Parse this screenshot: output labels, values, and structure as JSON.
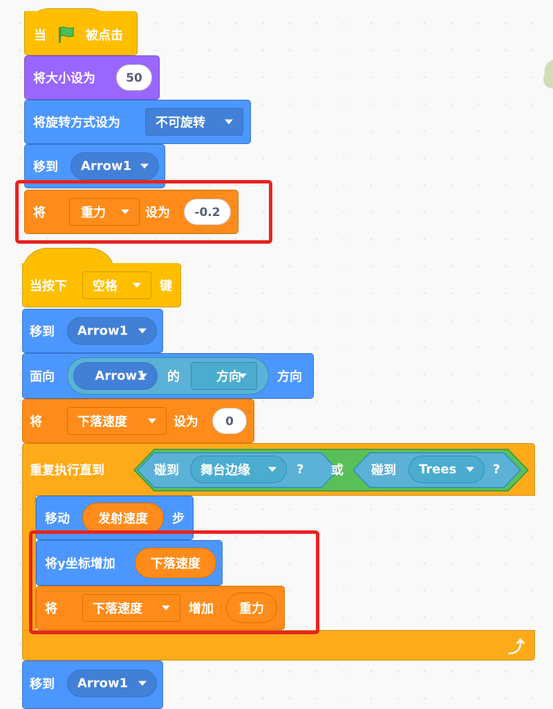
{
  "script1": {
    "when_label": "当",
    "clicked_label": "被点击",
    "set_size_label": "将大小设为",
    "set_size_value": "50",
    "set_rotation_label": "将旋转方式设为",
    "rotation_option": "不可旋转",
    "go_to_label": "移到",
    "go_to_target": "Arrow1",
    "set_var_label": "将",
    "set_var_name": "重力",
    "set_to_label": "设为",
    "set_var_value": "-0.2"
  },
  "script2": {
    "when_key_label": "当按下",
    "key_option": "空格",
    "key_suffix": "键",
    "go_to_label": "移到",
    "go_to_target": "Arrow1",
    "point_label": "面向",
    "of_object": "Arrow1",
    "of_label": "的",
    "of_property": "方向",
    "point_suffix": "方向",
    "set_var_label": "将",
    "set_var_name": "下落速度",
    "set_to_label": "设为",
    "set_var_value": "0",
    "repeat_until_label": "重复执行直到",
    "touching_label_1": "碰到",
    "touching_target_1": "舞台边缘",
    "question_1": "?",
    "or_label": "或",
    "touching_label_2": "碰到",
    "touching_target_2": "Trees",
    "question_2": "?",
    "move_label": "移动",
    "move_reporter": "发射速度",
    "steps_label": "步",
    "change_y_label": "将y坐标增加",
    "change_y_reporter": "下落速度",
    "change_var_label": "将",
    "change_var_name": "下落速度",
    "change_by_label": "增加",
    "change_var_reporter": "重力",
    "repeat_arrow": "⤴",
    "go_to_label_2": "移到",
    "go_to_target_2": "Arrow1"
  },
  "colors": {
    "events": "#ffbf00",
    "looks": "#9966ff",
    "motion": "#4c97ff",
    "variables": "#ff8c1a",
    "control": "#ffab19",
    "sensing": "#5cb1d6",
    "operators": "#59c059",
    "highlight": "#e8231e"
  }
}
